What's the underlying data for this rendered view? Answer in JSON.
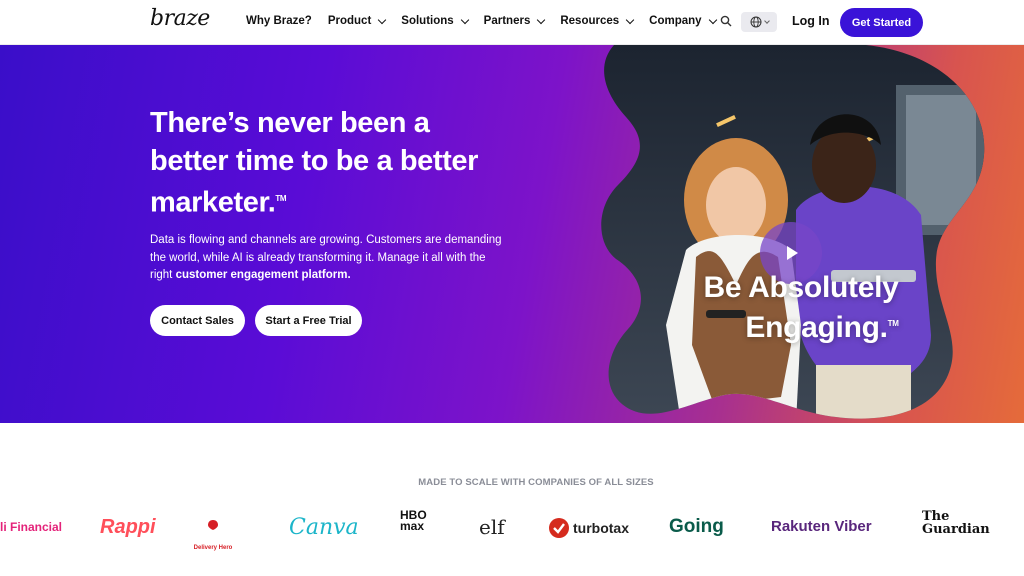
{
  "nav": {
    "logo": "braze",
    "items": [
      {
        "label": "Why Braze?",
        "dropdown": false
      },
      {
        "label": "Product",
        "dropdown": true
      },
      {
        "label": "Solutions",
        "dropdown": true
      },
      {
        "label": "Partners",
        "dropdown": true
      },
      {
        "label": "Resources",
        "dropdown": true
      },
      {
        "label": "Company",
        "dropdown": true
      }
    ],
    "search_icon": "search-icon",
    "language_icon": "globe-icon",
    "login": "Log In",
    "cta": "Get Started"
  },
  "hero": {
    "headline": "There’s never been a better time to be a better marketer.",
    "trademark": "TM",
    "body_prefix": "Data is flowing and channels are growing. Customers are demanding the world, while AI is already transforming it. Manage it all with the right ",
    "body_strong": "customer engagement platform.",
    "buttons": {
      "contact": "Contact Sales",
      "trial": "Start a Free Trial"
    },
    "video_tagline_1": "Be Absolutely",
    "video_tagline_2": "Engaging.",
    "tagline_tm": "TM"
  },
  "logos": {
    "title": "MADE TO SCALE WITH COMPANIES OF ALL SIZES",
    "brands": [
      "li Financial",
      "Rappi",
      "Delivery Hero",
      "Canva",
      "HBO max",
      "elf",
      "turbotax",
      "Going",
      "Rakuten Viber",
      "The Guardian"
    ]
  },
  "colors": {
    "brand_purple": "#3a13d8",
    "hero_start": "#3a0ec9",
    "hero_end": "#e56b3a"
  }
}
